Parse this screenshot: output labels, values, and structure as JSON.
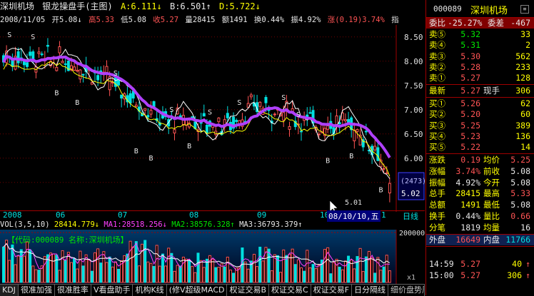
{
  "stock": {
    "code": "000089",
    "name": "深圳机场",
    "indicator": "银龙操盘手(主图)",
    "A": "A:6.111↓",
    "B": "B:6.501↑",
    "D": "D:5.722↓"
  },
  "ohlc_bar": {
    "date": "2008/11/05",
    "open": "开5.08↓",
    "high": "高5.33",
    "low": "低5.08",
    "close": "收5.27",
    "vol": "量28415",
    "amount": "额1491",
    "turnover": "换0.44%",
    "amplitude": "振4.92%",
    "change": "涨(0.19)3.74%",
    "tail": "指"
  },
  "price_axis": {
    "ticks": [
      "8.50",
      "8.00",
      "7.50",
      "7.00",
      "6.50",
      "6.00",
      "5.50"
    ],
    "current_tag": "(2473)",
    "current_price": "5.02"
  },
  "annotations": {
    "low_label": "5.01",
    "marker": "B"
  },
  "x_axis": {
    "labels": [
      "2008",
      "06",
      "07",
      "08",
      "09",
      "10"
    ],
    "cursor_date": "08/10/10,五",
    "cursor_tail": "1",
    "period": "日线"
  },
  "vol_info": {
    "title": "VOL(3,5,10)",
    "vol": "28414.779↓",
    "ma1": "MA1:28518.256↓",
    "ma2": "MA2:38576.328↑",
    "ma3": "MA3:36793.379↑",
    "axis": "200000",
    "axis_unit": "x1",
    "overlay": "【代码:000089 名称:深圳机场】"
  },
  "bottom_tabs": [
    "KDJ",
    "很准加强",
    "很准胜率",
    "V看盘助手",
    "机构K线",
    "(修V超级MACD",
    "权证交易B",
    "权证交易C",
    "权证交易F",
    "日分隔线",
    "细价盘势周指时讯成特释"
  ],
  "panel": {
    "commission_ratio_label": "委比",
    "commission_ratio": "-25.27%",
    "commission_diff_label": "委差",
    "commission_diff": "-467",
    "sell": [
      {
        "label": "卖⑤",
        "price": "5.32",
        "vol": "33"
      },
      {
        "label": "卖④",
        "price": "5.31",
        "vol": "2"
      },
      {
        "label": "卖③",
        "price": "5.30",
        "vol": "562"
      },
      {
        "label": "卖②",
        "price": "5.28",
        "vol": "233"
      },
      {
        "label": "卖①",
        "price": "5.27",
        "vol": "128"
      }
    ],
    "last": {
      "label": "最新",
      "price": "5.27",
      "label2": "现手",
      "vol": "306"
    },
    "buy": [
      {
        "label": "买①",
        "price": "5.26",
        "vol": "62"
      },
      {
        "label": "买②",
        "price": "5.20",
        "vol": "60"
      },
      {
        "label": "买③",
        "price": "5.25",
        "vol": "389"
      },
      {
        "label": "买④",
        "price": "5.23",
        "vol": "136"
      },
      {
        "label": "买⑤",
        "price": "5.22",
        "vol": "14"
      }
    ],
    "stats": [
      {
        "l1": "涨跌",
        "v1": "0.19",
        "l2": "均价",
        "v2": "5.25"
      },
      {
        "l1": "涨幅",
        "v1": "3.74%",
        "l2": "前收",
        "v2": "5.08"
      },
      {
        "l1": "振幅",
        "v1": "4.92%",
        "l2": "今开",
        "v2": "5.08"
      },
      {
        "l1": "总手",
        "v1": "28415",
        "l2": "最高",
        "v2": "5.33"
      },
      {
        "l1": "总额",
        "v1": "1491",
        "l2": "最低",
        "v2": "5.08"
      },
      {
        "l1": "换手",
        "v1": "0.44%",
        "l2": "量比",
        "v2": "0.66"
      },
      {
        "l1": "分笔",
        "v1": "1819",
        "l2": "均量",
        "v2": "16"
      }
    ],
    "outer": {
      "l1": "外盘",
      "v1": "16649",
      "l2": "内盘",
      "v2": "11766"
    },
    "ticks": [
      {
        "time": "14:59",
        "price": "5.27",
        "vol": "40",
        "dir": "↑"
      },
      {
        "time": "15:00",
        "price": "5.27",
        "vol": "306",
        "dir": "↑"
      }
    ],
    "last_tick_marker": "B"
  },
  "colors": {
    "up": "#ff5454",
    "down": "#00e0e0",
    "line_purple": "#b040ff",
    "line_yellow": "#ffff00",
    "line_white": "#ffffff",
    "grid": "#a00000"
  }
}
